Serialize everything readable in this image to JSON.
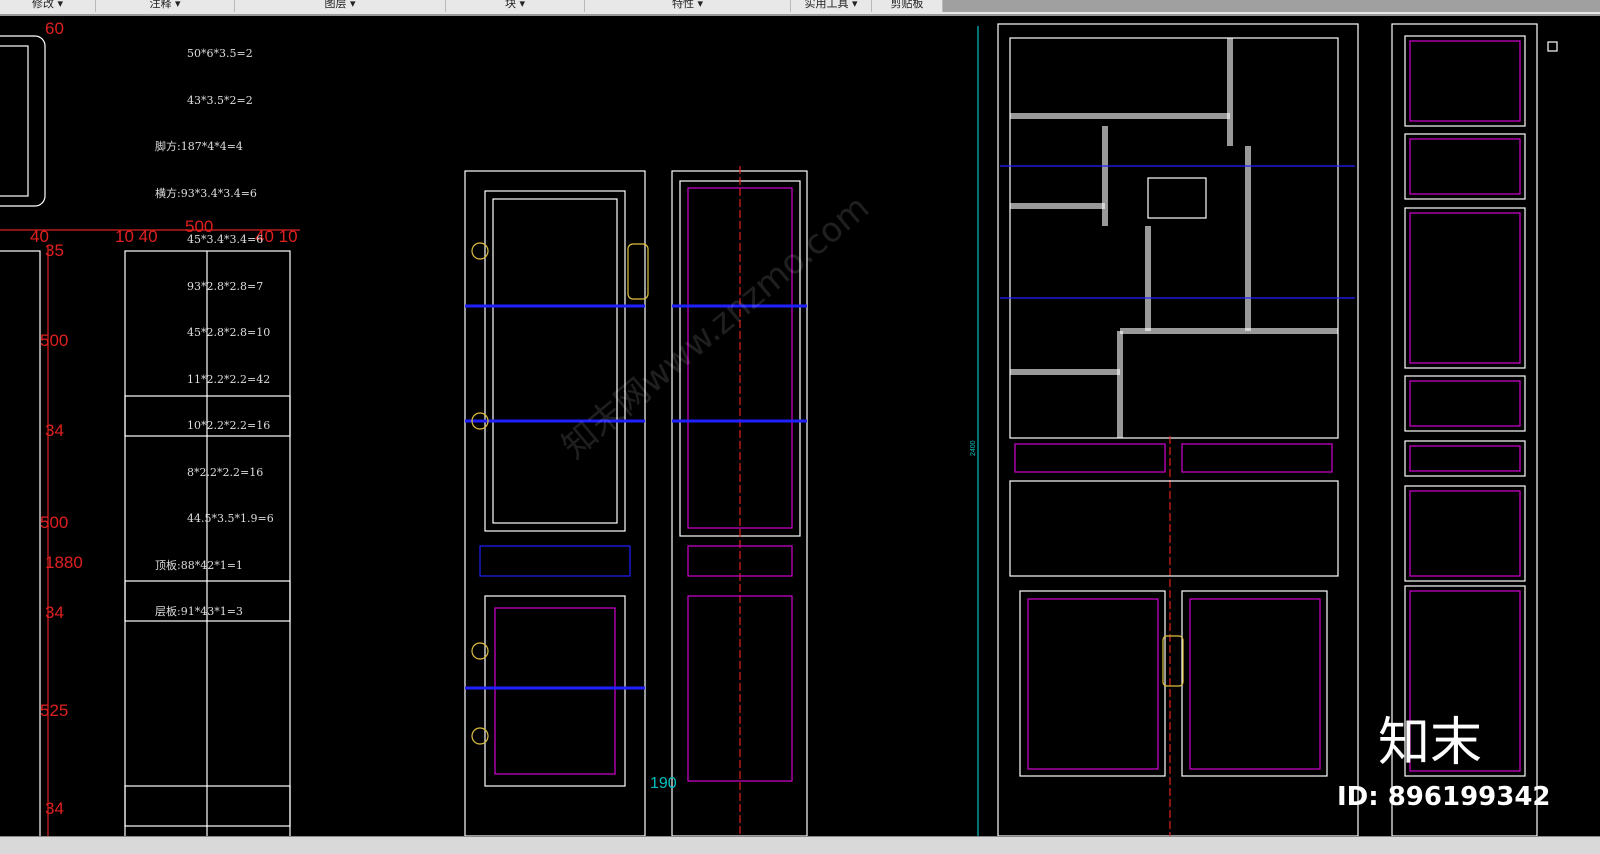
{
  "ribbon": {
    "panels": [
      "修改 ▾",
      "注释 ▾",
      "图层 ▾",
      "块 ▾",
      "特性 ▾",
      "实用工具 ▾",
      "剪贴板"
    ]
  },
  "notes": [
    "50*6*3.5=2",
    "43*3.5*2=2",
    "脚方:187*4*4=4",
    "横方:93*3.4*3.4=6",
    "45*3.4*3.4=6",
    "93*2.8*2.8=7",
    "45*2.8*2.8=10",
    "11*2.2*2.2=42",
    "10*2.2*2.2=16",
    "8*2.2*2.2=16",
    "44.5*3.5*1.9=6",
    "顶板:88*42*1=1",
    "层板:91*43*1=3"
  ],
  "dimensions": {
    "d60": "60",
    "d40a": "40",
    "d1040": "10 40",
    "d500top": "500",
    "d4010": "40 10",
    "d35": "35",
    "d500a": "500",
    "d34a": "34",
    "d500b": "500",
    "d1880": "1880",
    "d34b": "34",
    "d525": "525",
    "d34c": "34",
    "d190": "190",
    "d2400": "2400"
  },
  "watermark": {
    "logo": "知末",
    "id": "ID: 896199342",
    "text": "知末网www.znzmo.com"
  },
  "colors": {
    "frame": "#ffffff",
    "blue": "#2020ff",
    "magenta": "#d000d0",
    "red": "#e02020",
    "yellow": "#e0c040",
    "dim": "#00c0c0"
  }
}
